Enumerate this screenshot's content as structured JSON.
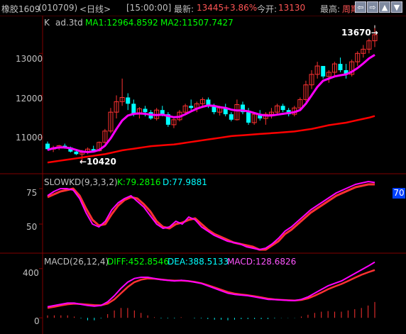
{
  "titlebar": {
    "instrument": "橡胶1609",
    "code": "(010709)",
    "period": "<日线>",
    "time": "[15:00:00]",
    "latest_label": "最新:",
    "latest_value": "13445",
    "change_pct": "+3.86%",
    "open_label": "今开:",
    "open_value": "13130",
    "high_label": "最高:",
    "high_value": "周期",
    "nav_buttons": [
      "⇦",
      "⇨",
      "▲",
      "▼",
      "◀",
      "▶"
    ]
  },
  "price_panel": {
    "header_k": "K",
    "header_indicator": "ad.3td",
    "ma1_text": "MA1:12964.8592",
    "ma2_text": "MA2:11507.7427",
    "y_ticks": [
      "13000",
      "12000",
      "11000"
    ],
    "high_annotation": "13670→",
    "low_annotation": "←10420"
  },
  "kd_panel": {
    "header": "SLOWKD(9,3,3,2)",
    "k_text": "K:79.2816",
    "d_text": "D:77.9881",
    "y_ticks": [
      "75",
      "50"
    ],
    "badge": "70"
  },
  "macd_panel": {
    "header": "MACD(26,12,4)",
    "diff_text": "DIFF:452.8546",
    "dea_text": "DEA:388.5133",
    "macd_text": "MACD:128.6826",
    "y_ticks": [
      "400",
      "0"
    ]
  },
  "colors": {
    "up": "#ff3232",
    "down": "#00ffff",
    "ma1": "#ff00ff",
    "ma2": "#ff0000",
    "grid": "#800000",
    "text_green": "#00ff00",
    "text_cyan": "#00ffff",
    "text_magenta": "#ff55ff"
  },
  "chart_data": {
    "type": "candlestick",
    "price": {
      "ylim": [
        10150,
        13900
      ],
      "candles": [
        [
          10850,
          10900,
          10700,
          10720
        ],
        [
          10720,
          10800,
          10650,
          10750
        ],
        [
          10750,
          10820,
          10700,
          10800
        ],
        [
          10800,
          10850,
          10730,
          10760
        ],
        [
          10760,
          10780,
          10640,
          10660
        ],
        [
          10660,
          10720,
          10580,
          10600
        ],
        [
          10600,
          10700,
          10420,
          10640
        ],
        [
          10640,
          10760,
          10600,
          10720
        ],
        [
          10720,
          10800,
          10640,
          10680
        ],
        [
          10680,
          10900,
          10660,
          10880
        ],
        [
          10880,
          11200,
          10850,
          11150
        ],
        [
          11150,
          11700,
          11100,
          11600
        ],
        [
          11600,
          12000,
          11450,
          11850
        ],
        [
          11850,
          12400,
          11750,
          11950
        ],
        [
          11950,
          12050,
          11650,
          11800
        ],
        [
          11800,
          11900,
          11500,
          11550
        ],
        [
          11550,
          11720,
          11450,
          11680
        ],
        [
          11680,
          11750,
          11500,
          11600
        ],
        [
          11600,
          11650,
          11420,
          11450
        ],
        [
          11450,
          11700,
          11400,
          11650
        ],
        [
          11650,
          11750,
          11500,
          11550
        ],
        [
          11550,
          11600,
          11250,
          11300
        ],
        [
          11300,
          11450,
          11220,
          11420
        ],
        [
          11420,
          11650,
          11380,
          11600
        ],
        [
          11600,
          11800,
          11550,
          11750
        ],
        [
          11750,
          11900,
          11650,
          11700
        ],
        [
          11700,
          11850,
          11600,
          11800
        ],
        [
          11800,
          11950,
          11700,
          11900
        ],
        [
          11900,
          11950,
          11700,
          11750
        ],
        [
          11750,
          11800,
          11550,
          11600
        ],
        [
          11600,
          11750,
          11520,
          11700
        ],
        [
          11700,
          11800,
          11500,
          11550
        ],
        [
          11550,
          11600,
          11380,
          11420
        ],
        [
          11420,
          11900,
          11400,
          11780
        ],
        [
          11780,
          11850,
          11550,
          11600
        ],
        [
          11600,
          11700,
          11300,
          11350
        ],
        [
          11350,
          11600,
          11300,
          11550
        ],
        [
          11550,
          11650,
          11400,
          11450
        ],
        [
          11450,
          11600,
          11300,
          11550
        ],
        [
          11550,
          11700,
          11450,
          11600
        ],
        [
          11600,
          11800,
          11550,
          11750
        ],
        [
          11750,
          11800,
          11600,
          11650
        ],
        [
          11650,
          11700,
          11500,
          11550
        ],
        [
          11550,
          11750,
          11500,
          11700
        ],
        [
          11700,
          11950,
          11650,
          11900
        ],
        [
          11900,
          12350,
          11850,
          12250
        ],
        [
          12250,
          12600,
          12150,
          12500
        ],
        [
          12500,
          12800,
          12400,
          12700
        ],
        [
          12700,
          12650,
          12400,
          12450
        ],
        [
          12450,
          12600,
          12300,
          12550
        ],
        [
          12550,
          12800,
          12450,
          12750
        ],
        [
          12750,
          12900,
          12550,
          12600
        ],
        [
          12600,
          12750,
          12400,
          12500
        ],
        [
          12500,
          12850,
          12450,
          12800
        ],
        [
          12800,
          13050,
          12700,
          13000
        ],
        [
          13000,
          13200,
          12900,
          13100
        ],
        [
          13100,
          13350,
          13000,
          13300
        ],
        [
          13300,
          13670,
          13150,
          13445
        ]
      ],
      "ma1": [
        10700,
        10740,
        10760,
        10760,
        10740,
        10700,
        10660,
        10650,
        10660,
        10700,
        10800,
        10980,
        11200,
        11400,
        11520,
        11560,
        11570,
        11560,
        11540,
        11530,
        11540,
        11510,
        11480,
        11490,
        11550,
        11620,
        11680,
        11730,
        11760,
        11750,
        11720,
        11700,
        11660,
        11640,
        11640,
        11620,
        11580,
        11540,
        11520,
        11520,
        11540,
        11560,
        11580,
        11600,
        11650,
        11800,
        12000,
        12200,
        12350,
        12400,
        12450,
        12480,
        12500,
        12560,
        12650,
        12760,
        12880,
        12965
      ],
      "ma2": [
        10400,
        10420,
        10440,
        10460,
        10480,
        10500,
        10520,
        10540,
        10560,
        10580,
        10600,
        10630,
        10660,
        10690,
        10710,
        10730,
        10750,
        10770,
        10790,
        10800,
        10810,
        10820,
        10830,
        10850,
        10870,
        10890,
        10910,
        10930,
        10950,
        10970,
        10990,
        11010,
        11030,
        11040,
        11050,
        11060,
        11070,
        11080,
        11090,
        11100,
        11110,
        11120,
        11130,
        11140,
        11160,
        11180,
        11200,
        11230,
        11260,
        11290,
        11310,
        11330,
        11350,
        11380,
        11410,
        11440,
        11470,
        11508
      ]
    },
    "kd": {
      "ylim": [
        30,
        85
      ],
      "k": [
        70,
        73,
        75,
        75,
        74,
        68,
        58,
        50,
        48,
        52,
        60,
        65,
        68,
        70,
        66,
        62,
        56,
        50,
        47,
        48,
        52,
        50,
        55,
        53,
        48,
        45,
        42,
        40,
        38,
        37,
        36,
        34,
        33,
        32,
        33,
        36,
        40,
        45,
        48,
        52,
        56,
        60,
        63,
        66,
        69,
        72,
        74,
        76,
        78,
        79,
        80,
        79.3
      ],
      "d": [
        69,
        71,
        73,
        74,
        75,
        70,
        61,
        53,
        49,
        50,
        57,
        63,
        67,
        69,
        68,
        64,
        59,
        52,
        48,
        47,
        50,
        51,
        53,
        54,
        50,
        46,
        43,
        41,
        39,
        37,
        36,
        35,
        34,
        32,
        32,
        35,
        38,
        43,
        46,
        50,
        54,
        58,
        61,
        64,
        67,
        70,
        72,
        74,
        76,
        77,
        78,
        78.0
      ]
    },
    "macd": {
      "ylim": [
        -120,
        520
      ],
      "diff": [
        90,
        100,
        110,
        120,
        120,
        110,
        100,
        95,
        100,
        130,
        180,
        240,
        290,
        320,
        330,
        330,
        320,
        310,
        305,
        300,
        305,
        300,
        290,
        280,
        260,
        240,
        220,
        200,
        190,
        185,
        180,
        170,
        160,
        150,
        148,
        145,
        142,
        140,
        150,
        170,
        200,
        230,
        260,
        280,
        300,
        330,
        360,
        390,
        420,
        452.9
      ],
      "dea": [
        80,
        90,
        100,
        110,
        115,
        112,
        108,
        103,
        102,
        115,
        150,
        200,
        250,
        290,
        310,
        320,
        318,
        312,
        306,
        302,
        303,
        300,
        292,
        282,
        265,
        247,
        228,
        210,
        197,
        190,
        184,
        176,
        166,
        156,
        150,
        146,
        143,
        141,
        145,
        158,
        180,
        205,
        232,
        255,
        275,
        300,
        325,
        350,
        370,
        388.5
      ],
      "hist": [
        20,
        20,
        20,
        20,
        10,
        -5,
        -20,
        -20,
        -5,
        30,
        60,
        80,
        80,
        60,
        40,
        20,
        5,
        -5,
        -5,
        -5,
        5,
        0,
        -5,
        -5,
        -10,
        -15,
        -15,
        -20,
        -15,
        -10,
        -10,
        -10,
        -10,
        -10,
        -5,
        -2,
        -2,
        -2,
        10,
        25,
        40,
        50,
        55,
        50,
        50,
        60,
        70,
        80,
        100,
        128.7
      ]
    }
  }
}
